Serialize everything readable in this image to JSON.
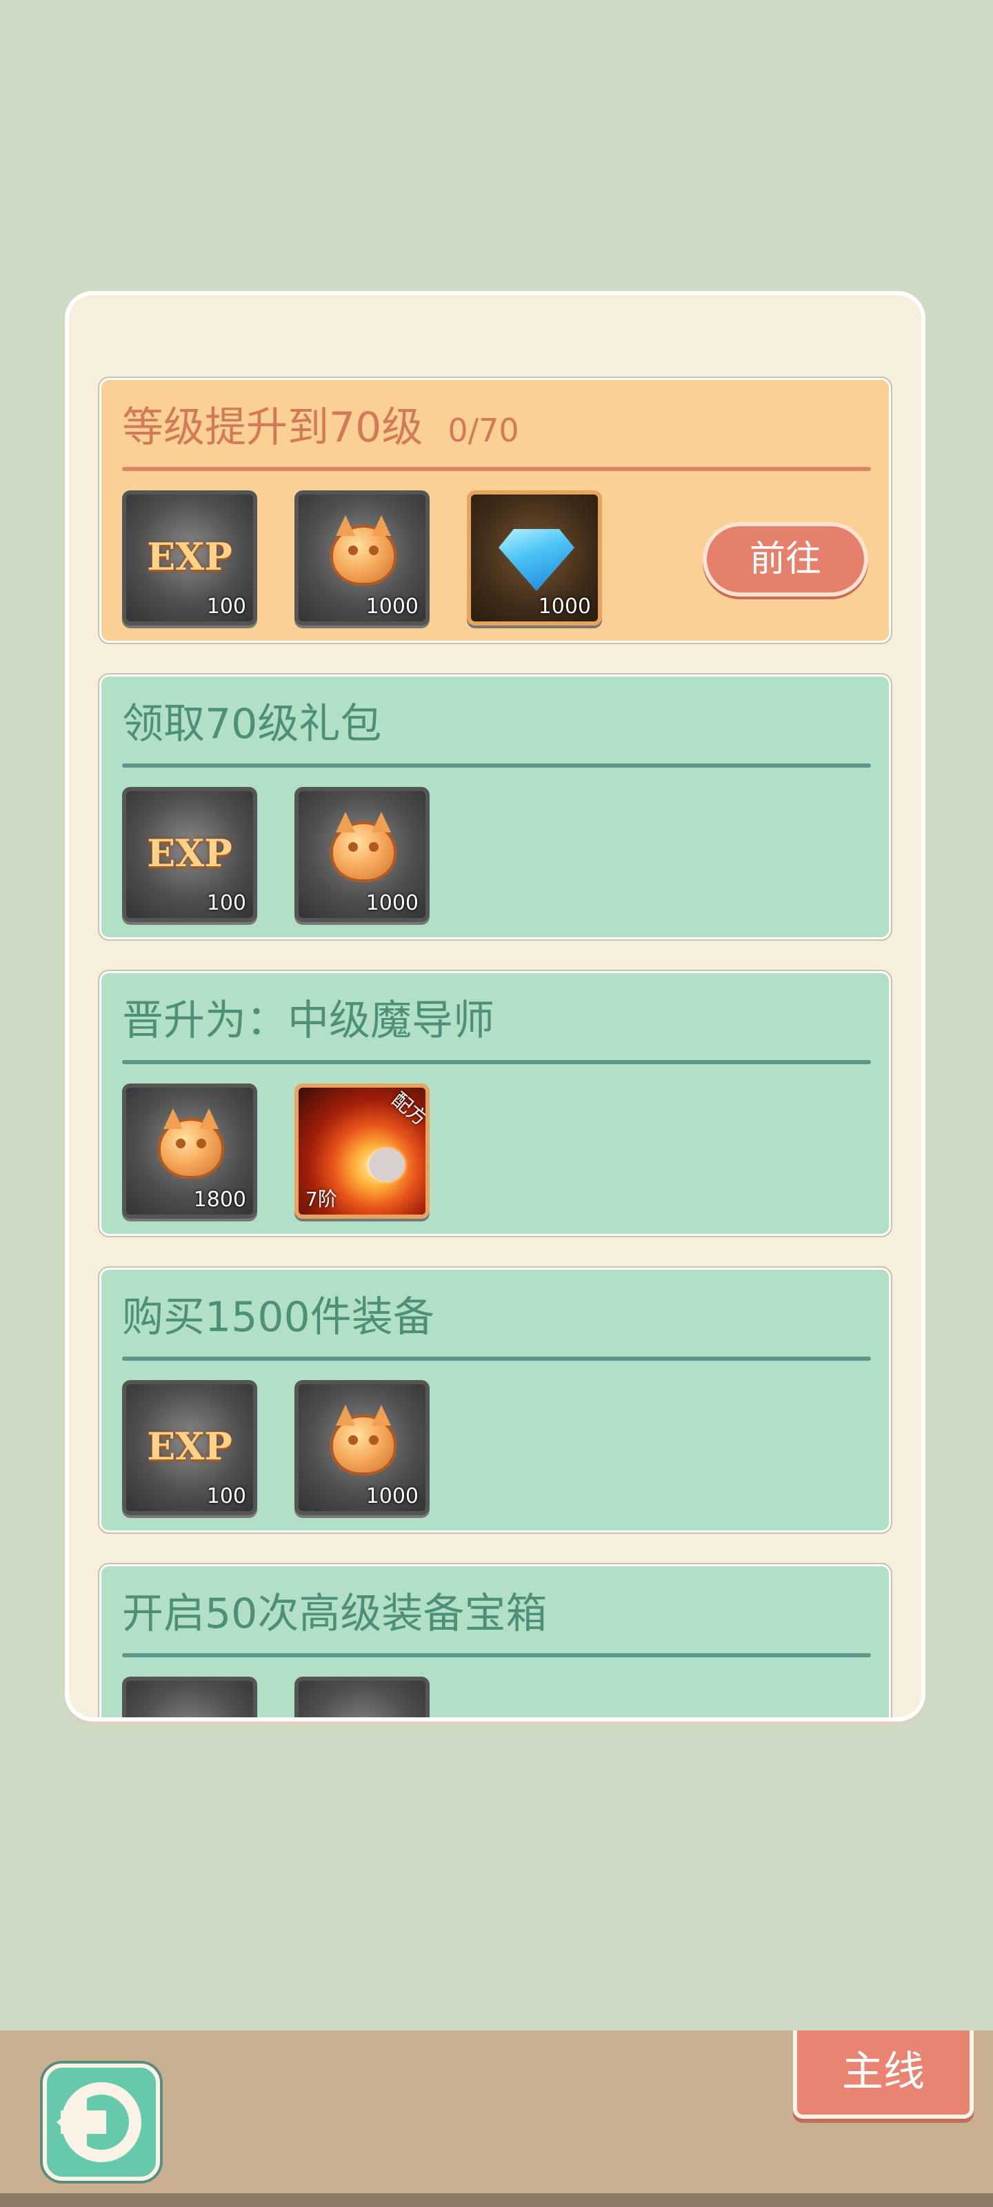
{
  "tasks": [
    {
      "title": "等级提升到70级",
      "progress": "0/70",
      "style": "orange",
      "action_label": "前往",
      "rewards": [
        {
          "icon": "exp-icon",
          "text": "EXP",
          "count": "100"
        },
        {
          "icon": "coin-icon",
          "count": "1000"
        },
        {
          "icon": "diamond-icon",
          "count": "1000"
        }
      ]
    },
    {
      "title": "领取70级礼包",
      "style": "green",
      "rewards": [
        {
          "icon": "exp-icon",
          "text": "EXP",
          "count": "100"
        },
        {
          "icon": "coin-icon",
          "count": "1000"
        }
      ]
    },
    {
      "title": "晋升为：中级魔导师",
      "style": "green",
      "rewards": [
        {
          "icon": "coin-icon",
          "count": "1800"
        },
        {
          "icon": "fireball-recipe-icon",
          "badge": "配方",
          "tier": "7阶"
        }
      ]
    },
    {
      "title": "购买1500件装备",
      "style": "green",
      "rewards": [
        {
          "icon": "exp-icon",
          "text": "EXP",
          "count": "100"
        },
        {
          "icon": "coin-icon",
          "count": "1000"
        }
      ]
    },
    {
      "title": "开启50次高级装备宝箱",
      "style": "green",
      "rewards": []
    }
  ],
  "footer": {
    "back_icon": "back-arrow-icon",
    "main_label": "主线"
  },
  "colors": {
    "background": "#cddbc5",
    "orange_task": "#fbd094",
    "green_task": "#b2e0c7",
    "button": "#e4806b"
  }
}
